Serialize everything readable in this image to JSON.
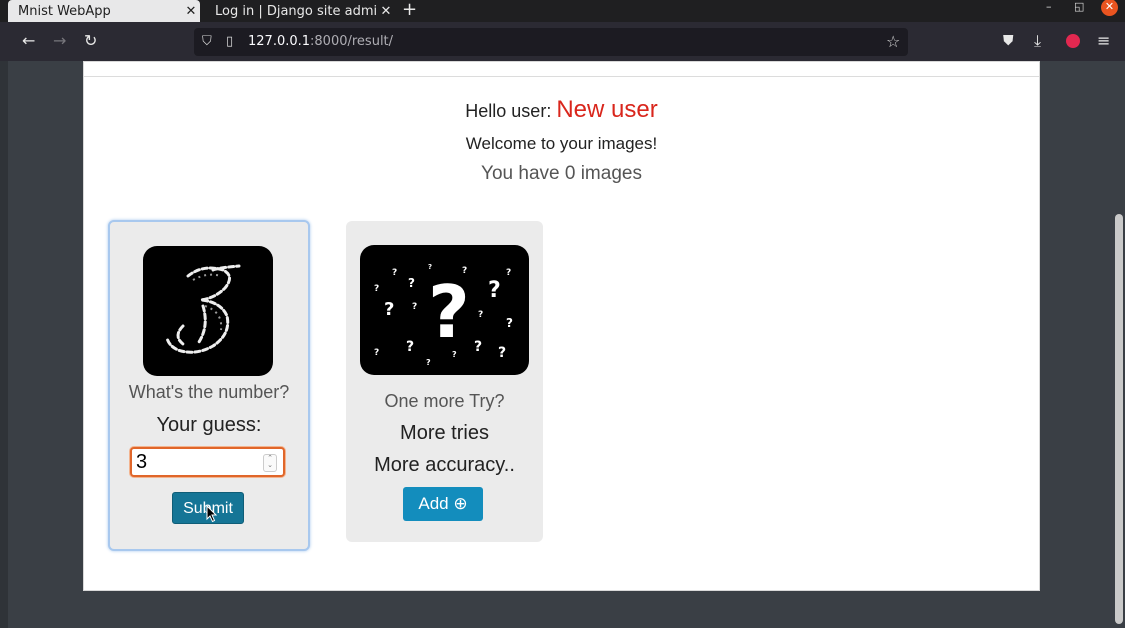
{
  "browser": {
    "tabs": [
      {
        "label": "Mnist WebApp",
        "active": true
      },
      {
        "label": "Log in | Django site admin",
        "active": false
      }
    ],
    "new_tab": "+",
    "url_host": "127.0.0.1",
    "url_rest": ":8000/result/",
    "window_controls": {
      "minimize": "–",
      "maximize": "◱",
      "close": "✕"
    }
  },
  "page": {
    "hello_prefix": "Hello user:",
    "username": "New user",
    "welcome": "Welcome to your images!",
    "image_count_text": "You have 0 images"
  },
  "guess_card": {
    "question": "What's the number?",
    "guess_label": "Your guess:",
    "guess_value": "3",
    "submit_label": "Submit"
  },
  "add_card": {
    "line1": "One more Try?",
    "line2": "More tries",
    "line3": "More accuracy..",
    "add_label": "Add ⊕"
  },
  "colors": {
    "username": "#d9261c",
    "submit_button": "#157596",
    "add_button": "#138dbd",
    "input_focus_border": "#e0662a"
  }
}
